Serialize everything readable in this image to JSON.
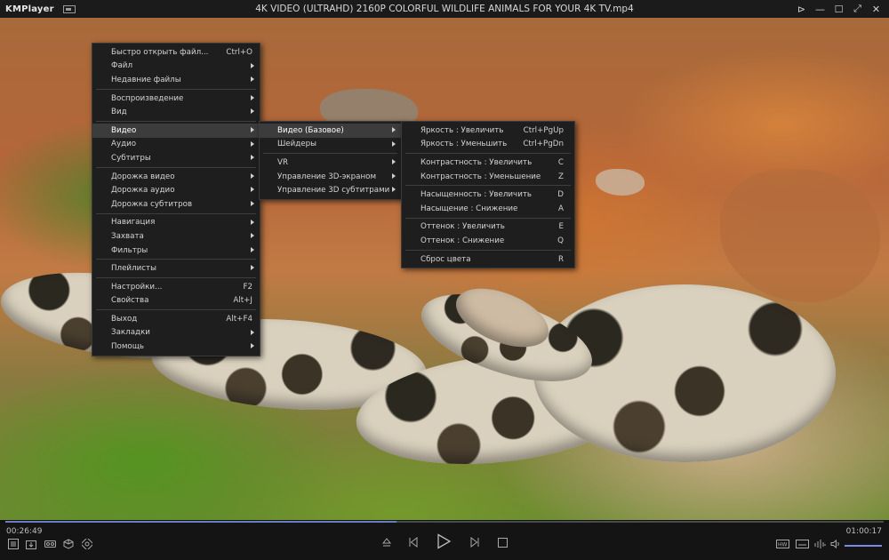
{
  "app": {
    "logo": "KMPlayer",
    "window_title": "4K VIDEO (ULTRAHD) 2160P COLORFUL WILDLIFE ANIMALS FOR YOUR 4K TV.mp4"
  },
  "window_controls": {
    "pin": "⊳",
    "minimize": "—",
    "maximize": "☐",
    "fullscreen": "⤢",
    "close": "✕"
  },
  "main_menu": {
    "quick_open": {
      "label": "Быстро открыть файл...",
      "shortcut": "Ctrl+O"
    },
    "file": "Файл",
    "recent": "Недавние файлы",
    "playback": "Воспроизведение",
    "view": "Вид",
    "video": "Видео",
    "audio": "Аудио",
    "subtitles": "Субтитры",
    "video_track": "Дорожка видео",
    "audio_track": "Дорожка аудио",
    "subtitle_track": "Дорожка субтитров",
    "navigation": "Навигация",
    "capture": "Захвата",
    "filters": "Фильтры",
    "playlists": "Плейлисты",
    "settings": {
      "label": "Настройки...",
      "shortcut": "F2"
    },
    "properties": {
      "label": "Свойства",
      "shortcut": "Alt+J"
    },
    "exit": {
      "label": "Выход",
      "shortcut": "Alt+F4"
    },
    "bookmarks": "Закладки",
    "help": "Помощь"
  },
  "video_menu": {
    "basic": "Видео (Базовое)",
    "shaders": "Шейдеры",
    "vr": "VR",
    "screen3d": "Управление 3D-экраном",
    "subs3d": "Управление 3D субтитрами"
  },
  "basic_menu": {
    "bright_up": {
      "label": "Яркость : Увеличить",
      "shortcut": "Ctrl+PgUp"
    },
    "bright_down": {
      "label": "Яркость : Уменьшить",
      "shortcut": "Ctrl+PgDn"
    },
    "contrast_up": {
      "label": "Контрастность : Увеличить",
      "shortcut": "C"
    },
    "contrast_down": {
      "label": "Контрастность : Уменьшение",
      "shortcut": "Z"
    },
    "sat_up": {
      "label": "Насыщенность : Увеличить",
      "shortcut": "D"
    },
    "sat_down": {
      "label": "Насыщение : Снижение",
      "shortcut": "A"
    },
    "hue_up": {
      "label": "Оттенок : Увеличить",
      "shortcut": "E"
    },
    "hue_down": {
      "label": "Оттенок : Снижение",
      "shortcut": "Q"
    },
    "reset": {
      "label": "Сброс цвета",
      "shortcut": "R"
    }
  },
  "player": {
    "current_time": "00:26:49",
    "total_time": "01:00:17",
    "progress": 0.445,
    "volume": 1.0,
    "accent_color": "#6a7cc8"
  }
}
